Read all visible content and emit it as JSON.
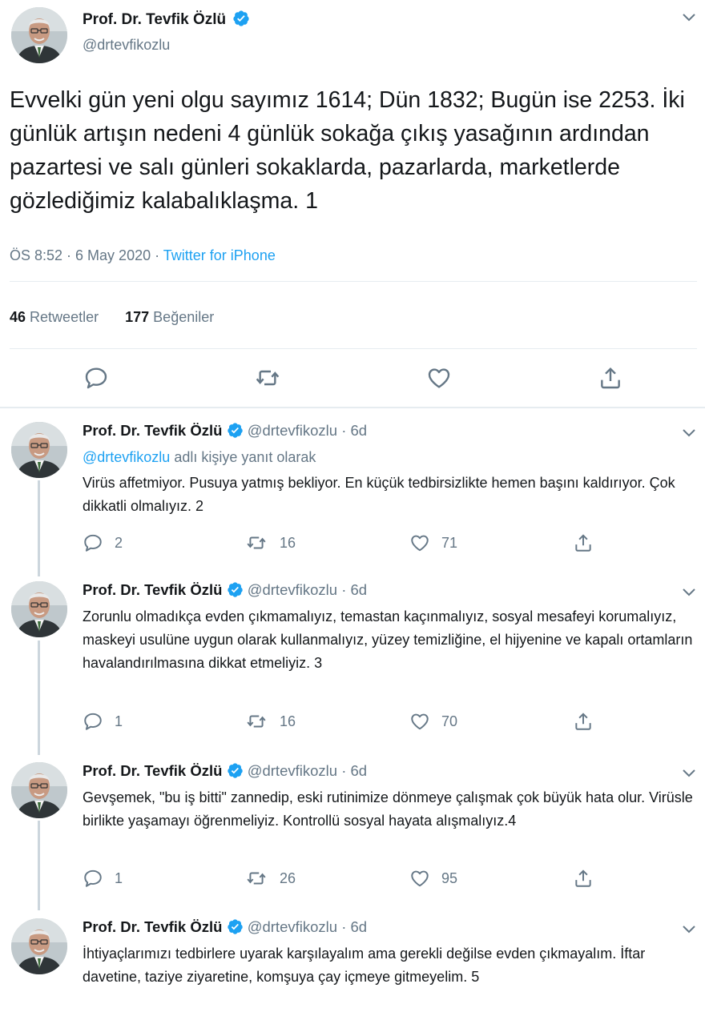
{
  "main": {
    "name": "Prof. Dr. Tevfik Özlü",
    "handle": "@drtevfikozlu",
    "text": "Evvelki gün yeni olgu sayımız 1614; Dün 1832; Bugün ise 2253. İki günlük artışın nedeni 4 günlük sokağa çıkış yasağının ardından pazartesi ve salı günleri sokaklarda, pazarlarda, marketlerde gözlediğimiz kalabalıklaşma. 1",
    "time": "ÖS 8:52 · 6 May 2020 · ",
    "source": "Twitter for iPhone",
    "retweets_count": "46",
    "retweets_label": "Retweetler",
    "likes_count": "177",
    "likes_label": "Beğeniler"
  },
  "replies": [
    {
      "name": "Prof. Dr. Tevfik Özlü",
      "handle": "@drtevfikozlu",
      "age": "· 6d",
      "reply_to_handle": "@drtevfikozlu",
      "reply_to_suffix": " adlı kişiye yanıt olarak",
      "text": "Virüs affetmiyor. Pusuya yatmış bekliyor. En küçük tedbirsizlikte hemen başını kaldırıyor. Çok dikkatli olmalıyız. 2",
      "replies": "2",
      "retweets": "16",
      "likes": "71"
    },
    {
      "name": "Prof. Dr. Tevfik Özlü",
      "handle": "@drtevfikozlu",
      "age": "· 6d",
      "text": "Zorunlu olmadıkça evden çıkmamalıyız, temastan kaçınmalıyız, sosyal mesafeyi korumalıyız, maskeyi usulüne uygun olarak kullanmalıyız, yüzey temizliğine, el hijyenine ve kapalı ortamların havalandırılmasına dikkat etmeliyiz. 3",
      "replies": "1",
      "retweets": "16",
      "likes": "70"
    },
    {
      "name": "Prof. Dr. Tevfik Özlü",
      "handle": "@drtevfikozlu",
      "age": "· 6d",
      "text": "Gevşemek, \"bu iş bitti\" zannedip, eski rutinimize dönmeye çalışmak çok büyük hata olur. Virüsle birlikte yaşamayı öğrenmeliyiz. Kontrollü sosyal hayata alışmalıyız.4",
      "replies": "1",
      "retweets": "26",
      "likes": "95"
    },
    {
      "name": "Prof. Dr. Tevfik Özlü",
      "handle": "@drtevfikozlu",
      "age": "· 6d",
      "text": "İhtiyaçlarımızı tedbirlere uyarak karşılayalım ama gerekli değilse evden çıkmayalım. İftar davetine, taziye ziyaretine, komşuya çay içmeye gitmeyelim. 5"
    }
  ],
  "icons": {
    "reply": "reply-icon",
    "retweet": "retweet-icon",
    "like": "heart-icon",
    "share": "share-icon",
    "verified": "verified-badge-icon",
    "more": "chevron-down-icon"
  },
  "colors": {
    "accent": "#1da1f2",
    "muted": "#657786",
    "divider": "#e6ecf0"
  }
}
